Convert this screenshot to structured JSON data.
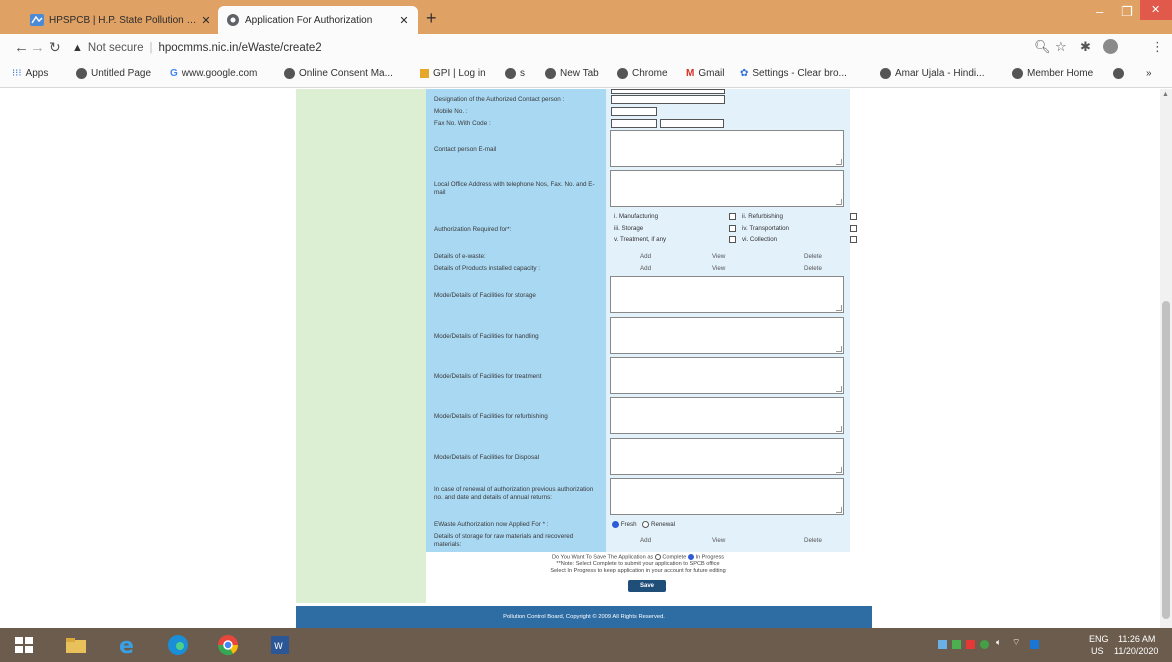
{
  "browser": {
    "tabs": [
      {
        "title": "HPSPCB | H.P. State Pollution Co",
        "active": false
      },
      {
        "title": "Application For Authorization",
        "active": true
      }
    ],
    "security_label": "Not secure",
    "url": "hpocmms.nic.in/eWaste/create2",
    "bookmarks": [
      "Apps",
      "Untitled Page",
      "www.google.com",
      "Online Consent Ma...",
      "GPI | Log in",
      "s",
      "New Tab",
      "Chrome",
      "Gmail",
      "Settings - Clear bro...",
      "Amar Ujala - Hindi...",
      "Member Home"
    ],
    "overflow": "»"
  },
  "form": {
    "fields": {
      "designation": "Designation of the Authorized Contact person :",
      "mobile": "Mobile No. :",
      "fax": "Fax No. With Code :",
      "email": "Contact person E-mail",
      "local_office": "Local Office Address with telephone Nos, Fax. No. and E-mail",
      "authorization": "Authorization Required for*:",
      "ewaste_details": "Details of e-waste:",
      "products_capacity": "Details of Products installed capacity :",
      "storage": "Mode/Details of Facilities for storage",
      "handling": "Mode/Details of Facilities for handling",
      "treatment": "Mode/Details of Facilities for treatment",
      "refurbishing": "Mode/Details of Facilities for refurbishing",
      "disposal": "Mode/Details of Facilities for Disposal",
      "renewal": "In case of renewal of authorization previous authorization no. and date and details of annual returns:",
      "applied_for": "EWaste Authorization now Applied For * :",
      "raw_storage": "Details of storage for raw materials and recovered materials:"
    },
    "auth_options": [
      "i. Manufacturing",
      "ii. Refurbishing",
      "iii. Storage",
      "iv. Transportation",
      "v. Treatment, if any",
      "vi. Collection"
    ],
    "links": {
      "add": "Add",
      "view": "View",
      "delete": "Delete"
    },
    "applied_for_options": {
      "fresh": "Fresh",
      "renewal": "Renewal"
    },
    "save_question": "Do You Want To Save The Application as",
    "save_complete": "Complete",
    "save_in_progress": "In Progress",
    "note_line1": "**Note: Select Complete to submit your application to SPCB office",
    "note_line2": "Select In Progress to keep application in your account for future editing",
    "save_button": "Save"
  },
  "footer": "Pollution Control Board, Copyright © 2009 All Rights Reserved.",
  "taskbar": {
    "lang": "ENG",
    "region": "US",
    "time": "11:26 AM",
    "date": "11/20/2020"
  },
  "colors": {
    "tabbar": "#e0a165",
    "form_label_bg": "#a9d8f3",
    "left_panel": "#dcefd2",
    "footer": "#2e6da4"
  }
}
